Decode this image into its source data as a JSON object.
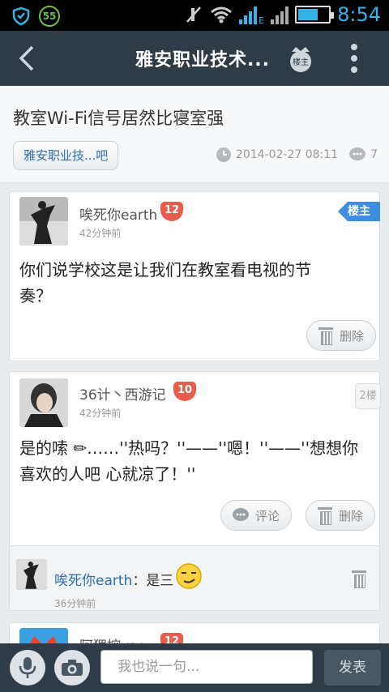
{
  "status_bar": {
    "battery_badge": "55",
    "time": "8:54",
    "network_label": "E"
  },
  "header": {
    "title": "雅安职业技术...",
    "crown_label": "楼主"
  },
  "post": {
    "title": "教室Wi-Fi信号居然比寝室强",
    "forum_tag": "雅安职业技...吧",
    "date": "2014-02-27 08:11",
    "comment_count": "7"
  },
  "posts": [
    {
      "username": "唉死你earth",
      "level": "12",
      "time": "42分钟前",
      "badge": "楼主",
      "content_line1": "你们说学校这是让我们在教室看电视的节",
      "content_line2": "奏？",
      "delete_label": "删除"
    },
    {
      "username": "36计丶西游记",
      "level": "10",
      "time": "42分钟前",
      "floor": "2楼",
      "content_line1": "是的嗦 ✏……''热吗？''——''嗯！''——''想想你",
      "content_line2": "喜欢的人吧 心就凉了！''",
      "comment_label": "评论",
      "delete_label": "删除",
      "reply": {
        "user": "唉死你earth",
        "separator": "：",
        "text": "是三",
        "time": "36分钟前"
      }
    },
    {
      "username": "阿狸控yao",
      "level": "12"
    }
  ],
  "bottom_bar": {
    "input_placeholder": "我也说一句...",
    "send_label": "发表"
  },
  "colors": {
    "header_bg": "#2f3b46",
    "accent_blue": "#3d8ee0",
    "level_badge": "#e85d4a",
    "link_blue": "#2c6db3"
  }
}
